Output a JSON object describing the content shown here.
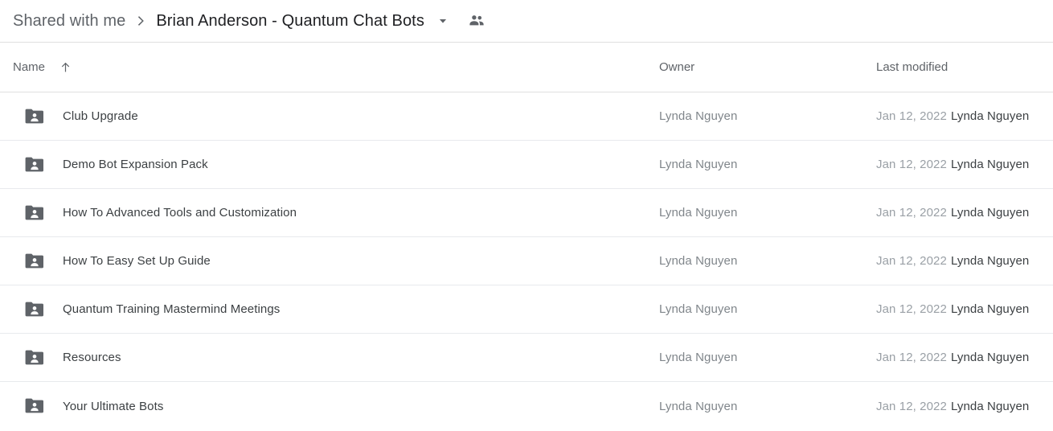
{
  "breadcrumb": {
    "parent_label": "Shared with me",
    "separator_icon": "chevron-right-icon",
    "current_label": "Brian Anderson - Quantum Chat Bots",
    "caret_icon": "chevron-down-icon",
    "people_icon": "people-shared-icon"
  },
  "columns": {
    "name": "Name",
    "sort_icon": "arrow-up-icon",
    "owner": "Owner",
    "last_modified": "Last modified"
  },
  "colors": {
    "text_primary": "#3c4043",
    "text_secondary": "#5f6368",
    "text_muted": "#9aa0a6",
    "icon_gray": "#5f6368",
    "divider": "#e0e0e0",
    "row_divider": "#e8eaed",
    "background": "#ffffff"
  },
  "rows": [
    {
      "icon": "shared-folder-icon",
      "name": "Club Upgrade",
      "owner": "Lynda Nguyen",
      "modified_date": "Jan 12, 2022",
      "modified_by": "Lynda Nguyen"
    },
    {
      "icon": "shared-folder-icon",
      "name": "Demo Bot Expansion Pack",
      "owner": "Lynda Nguyen",
      "modified_date": "Jan 12, 2022",
      "modified_by": "Lynda Nguyen"
    },
    {
      "icon": "shared-folder-icon",
      "name": "How To Advanced Tools and Customization",
      "owner": "Lynda Nguyen",
      "modified_date": "Jan 12, 2022",
      "modified_by": "Lynda Nguyen"
    },
    {
      "icon": "shared-folder-icon",
      "name": "How To Easy Set Up Guide",
      "owner": "Lynda Nguyen",
      "modified_date": "Jan 12, 2022",
      "modified_by": "Lynda Nguyen"
    },
    {
      "icon": "shared-folder-icon",
      "name": "Quantum Training Mastermind Meetings",
      "owner": "Lynda Nguyen",
      "modified_date": "Jan 12, 2022",
      "modified_by": "Lynda Nguyen"
    },
    {
      "icon": "shared-folder-icon",
      "name": "Resources",
      "owner": "Lynda Nguyen",
      "modified_date": "Jan 12, 2022",
      "modified_by": "Lynda Nguyen"
    },
    {
      "icon": "shared-folder-icon",
      "name": "Your Ultimate Bots",
      "owner": "Lynda Nguyen",
      "modified_date": "Jan 12, 2022",
      "modified_by": "Lynda Nguyen"
    }
  ]
}
